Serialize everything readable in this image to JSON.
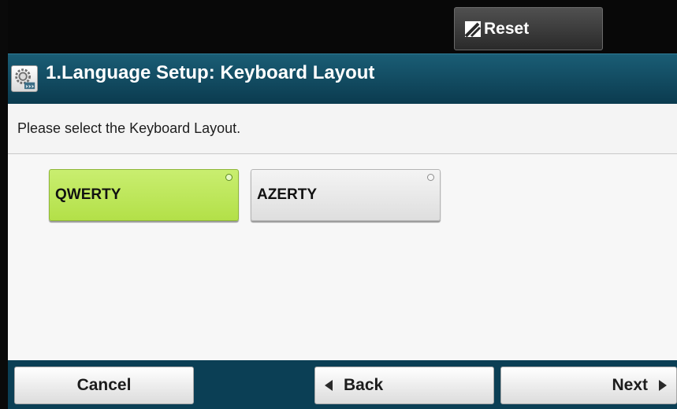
{
  "header": {
    "reset_label": "Reset"
  },
  "titlebar": {
    "title": "1.Language Setup: Keyboard Layout",
    "icon": "settings-gear-icon"
  },
  "instruction": "Please select the Keyboard Layout.",
  "options": [
    {
      "label": "QWERTY",
      "selected": true
    },
    {
      "label": "AZERTY",
      "selected": false
    }
  ],
  "footer": {
    "cancel_label": "Cancel",
    "back_label": "Back",
    "next_label": "Next"
  },
  "colors": {
    "title_bar": "#0b3b4f",
    "selected_option": "#bfe85f",
    "unselected_option": "#e8e8e8",
    "bottom_bar": "#0b3f55"
  }
}
